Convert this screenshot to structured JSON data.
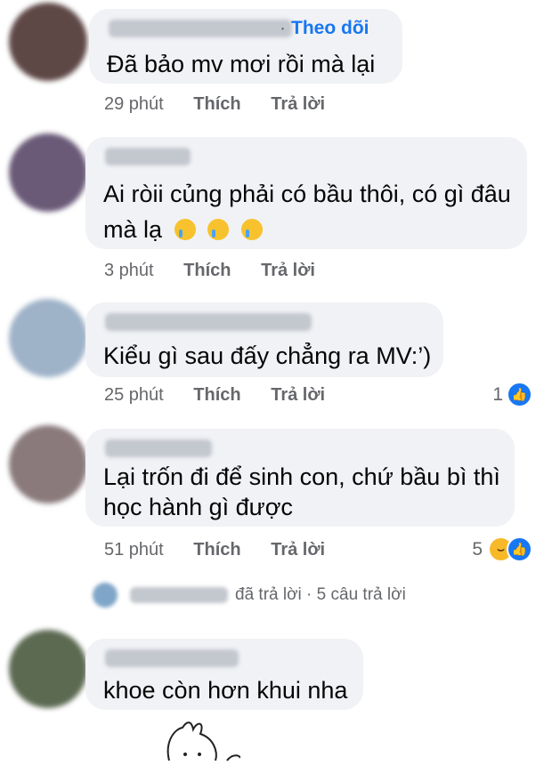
{
  "comments": [
    {
      "author": "Nguyễn Thị Thu Bảo",
      "follow_label": "Theo dõi",
      "text_lines": [
        "Đã bảo mv mơi rồi mà lại"
      ],
      "time": "29 phút",
      "like_label": "Thích",
      "reply_label": "Trả lời",
      "avatar_color": "#5e4846"
    },
    {
      "author": "Thu Minh",
      "text_lines": [
        "Ai ròii củng phải có bầu thôi, có gì đâu",
        "mà lạ"
      ],
      "emoji_icons": [
        "crying-face",
        "crying-face",
        "crying-face"
      ],
      "time": "3 phút",
      "like_label": "Thích",
      "reply_label": "Trả lời",
      "avatar_color": "#6a5a78"
    },
    {
      "author": "Nguyễn Thị Bích Ngọc",
      "text_lines": [
        "Kiểu gì sau đấy chẳng ra MV:’)"
      ],
      "time": "25 phút",
      "like_label": "Thích",
      "reply_label": "Trả lời",
      "reaction_count": "1",
      "reactions": [
        "like"
      ],
      "avatar_color": "#9eb2c8"
    },
    {
      "author": "Hien Luong",
      "text_lines": [
        "Lại trốn đi để sinh con, chứ bầu bì thì",
        "học hành gì được"
      ],
      "time": "51 phút",
      "like_label": "Thích",
      "reply_label": "Trả lời",
      "reaction_count": "5",
      "reactions": [
        "haha",
        "like"
      ],
      "avatar_color": "#8a7a7c"
    },
    {
      "author": "Phương Hoàng",
      "text_lines": [
        "khoe còn hơn khui nha"
      ],
      "avatar_color": "#5c6a52"
    }
  ],
  "reply_summary": {
    "author": "Gió Thoảng",
    "replied_label": "đã trả lời",
    "count_label": "5 câu trả lời"
  },
  "colors": {
    "bubble": "#f0f2f5",
    "link_blue": "#1877f2",
    "secondary_text": "#65676b",
    "like_blue": "#1877f2",
    "haha_yellow": "#f7b928"
  }
}
